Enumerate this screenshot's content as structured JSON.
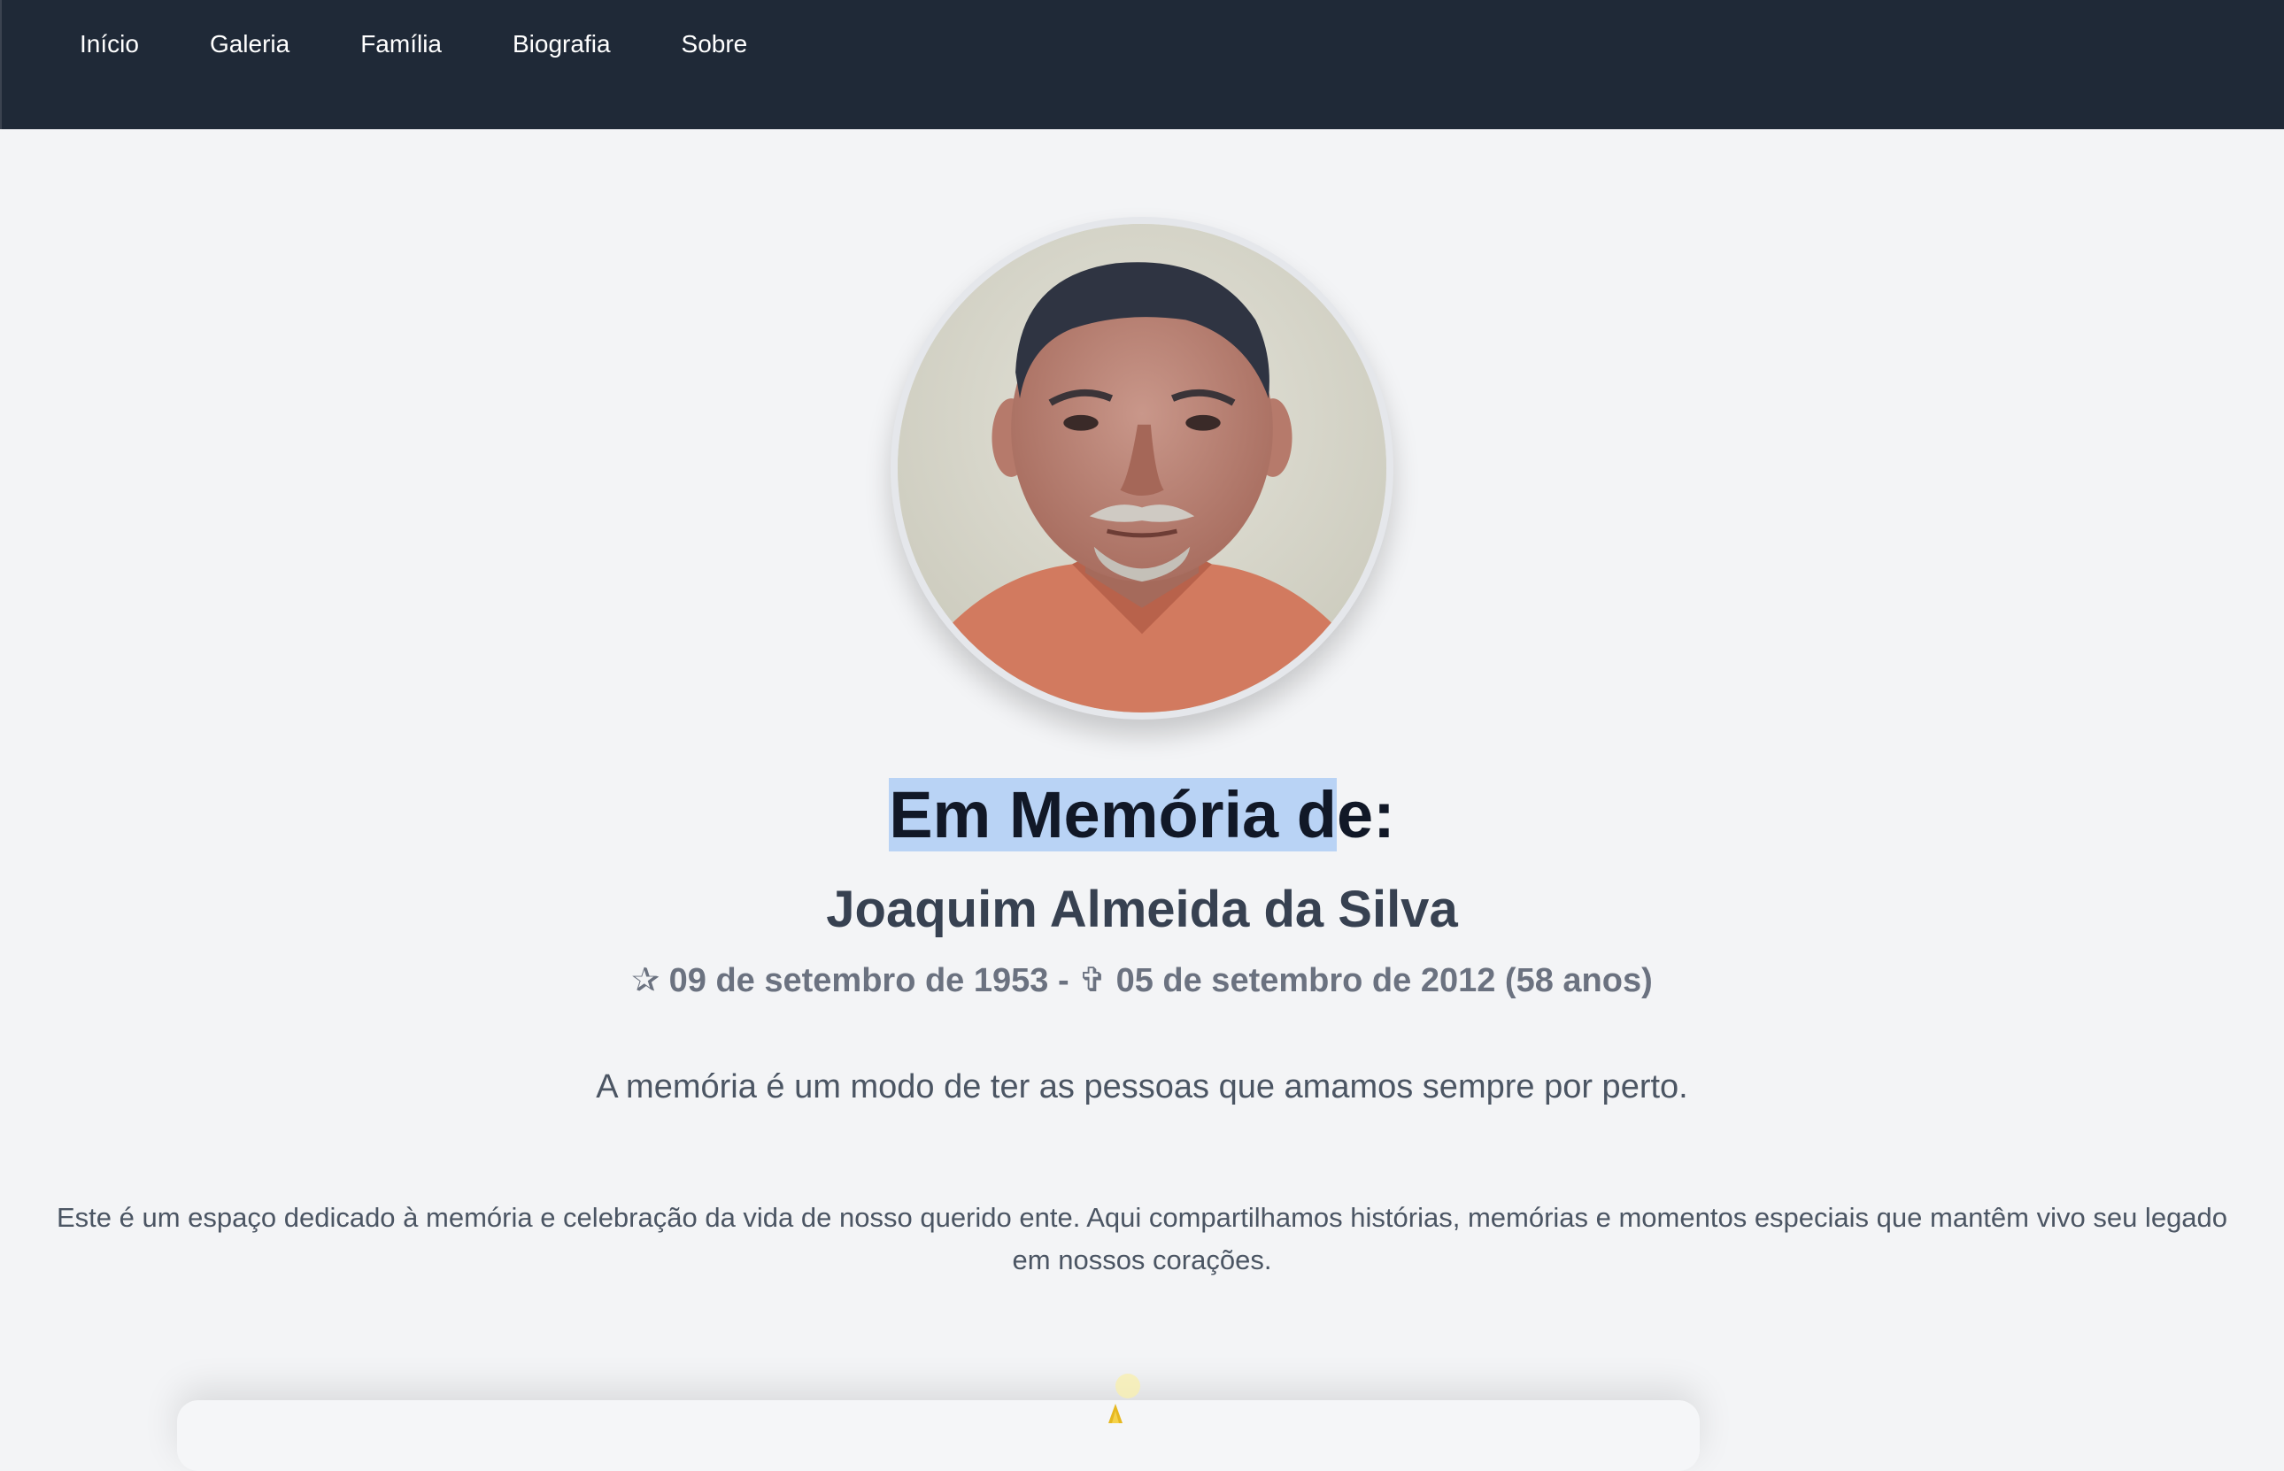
{
  "nav": {
    "items": [
      {
        "label": "Início"
      },
      {
        "label": "Galeria"
      },
      {
        "label": "Família"
      },
      {
        "label": "Biografia"
      },
      {
        "label": "Sobre"
      }
    ]
  },
  "memorial": {
    "heading_selected": "Em Memória d",
    "heading_rest": "e:",
    "name": "Joaquim Almeida da Silva",
    "dates": "✰ 09 de setembro de 1953 - ✞ 05 de setembro de 2012 (58 anos)",
    "quote": "A memória é um modo de ter as pessoas que amamos sempre por perto.",
    "intro": "Este é um espaço dedicado à memória e celebração da vida de nosso querido ente. Aqui compartilhamos histórias, memórias e momentos especiais que mantêm vivo seu legado em nossos corações."
  },
  "icons": {
    "portrait": "portrait-photo",
    "candle": "candle-flame-icon"
  },
  "colors": {
    "navbar": "#1f2937",
    "background": "#f3f4f6",
    "heading": "#111827",
    "selection": "#b9d3f5",
    "flame": "#f5d24a"
  }
}
